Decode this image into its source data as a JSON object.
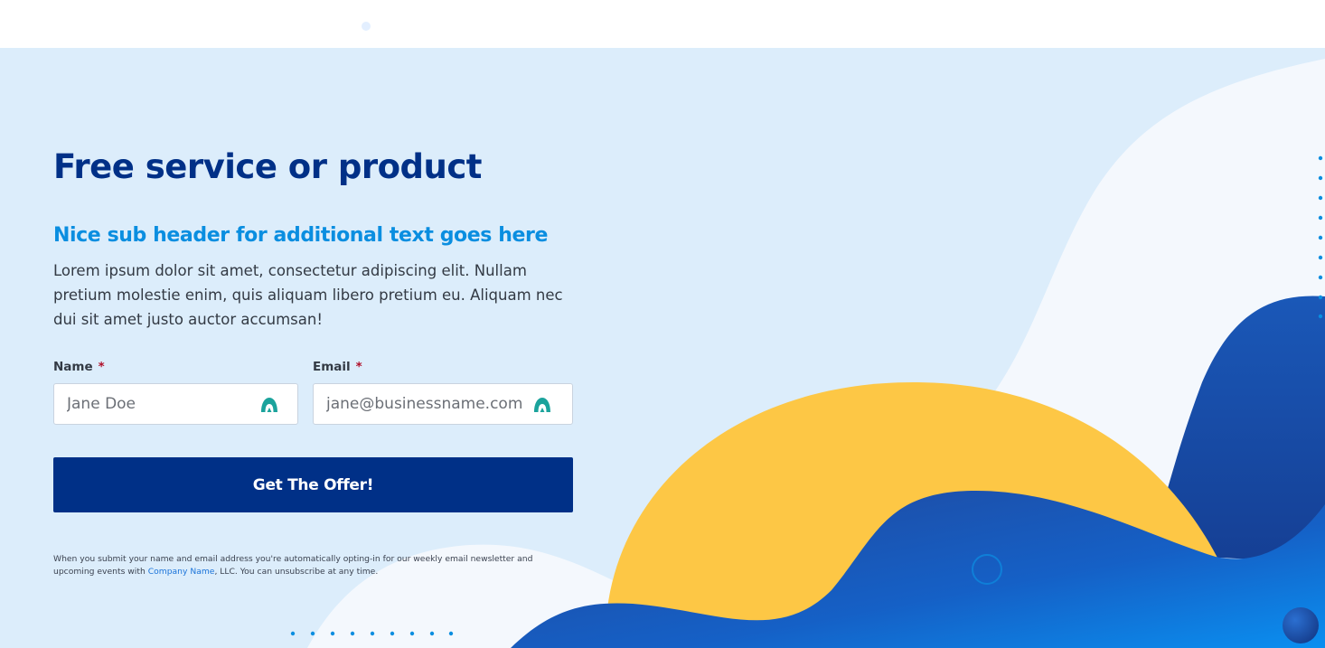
{
  "hero": {
    "title": "Free service or product",
    "subheader": "Nice sub header for additional text goes here",
    "body": "Lorem ipsum dolor sit amet, consectetur adipiscing elit. Nullam pretium molestie enim, quis aliquam libero pretium eu. Aliquam nec dui sit amet justo auctor accumsan!"
  },
  "form": {
    "name": {
      "label": "Name",
      "required_mark": "*",
      "placeholder": "Jane Doe"
    },
    "email": {
      "label": "Email",
      "required_mark": "*",
      "placeholder": "jane@businessname.com"
    },
    "submit_label": "Get The Offer!",
    "disclaimer": {
      "before_link": "When you submit your name and email address you're automatically opting-in for our weekly email newsletter and upcoming events with ",
      "link_text": "Company Name",
      "after_link": ", LLC. You can unsubscribe at any time."
    }
  },
  "icons": {
    "field_icon": "autofill-icon",
    "field_icon_color": "#1ba39c"
  },
  "colors": {
    "hero_bg": "#dcedfb",
    "title": "#003087",
    "subheader": "#0a8ee0",
    "button": "#003087",
    "accent_yellow": "#fdc745",
    "accent_blue": "#1d5fbf",
    "link": "#1a73d9"
  }
}
